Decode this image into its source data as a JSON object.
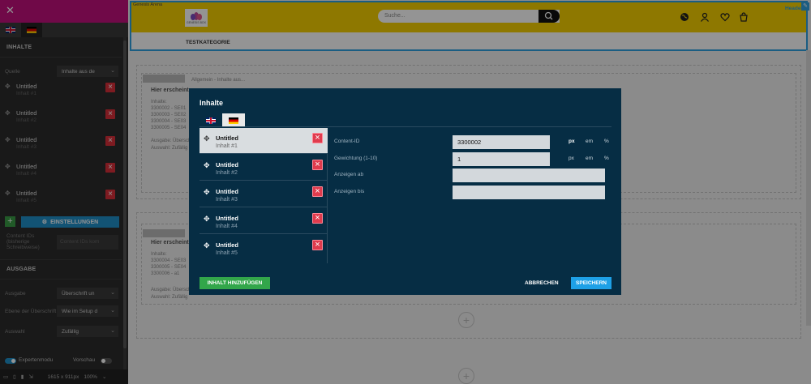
{
  "sidebar": {
    "flags": [
      "flag-uk-icon",
      "flag-de-icon"
    ],
    "section_contents": "INHALTE",
    "source_label": "Quelle",
    "source_value": "Inhalte aus de",
    "items": [
      {
        "title": "Untitled",
        "sub": "Inhalt #1"
      },
      {
        "title": "Untitled",
        "sub": "Inhalt #2"
      },
      {
        "title": "Untitled",
        "sub": "Inhalt #3"
      },
      {
        "title": "Untitled",
        "sub": "Inhalt #4"
      },
      {
        "title": "Untitled",
        "sub": "Inhalt #5"
      }
    ],
    "settings_label": "EINSTELLUNGEN",
    "content_ids_label": "Content IDs (bisherige Schreibweise)",
    "content_ids_placeholder": "Content IDs kom",
    "section_output": "AUSGABE",
    "output_label": "Ausgabe",
    "output_value": "Überschrift un",
    "level_label": "Ebene der Überschrift",
    "level_value": "Wie im Setup d",
    "selection_label": "Auswahl",
    "selection_value": "Zufällig",
    "expert_mode": "Expertenmodu",
    "preview": "Vorschau",
    "resolution": "1615 x 911px",
    "zoom": "100%"
  },
  "page": {
    "header_tag": "Genesis Arena",
    "header_name": "Header",
    "logo_text": "GENESIS BOX",
    "search_placeholder": "Suche...",
    "nav_item": "TESTKATEGORIE",
    "block1_placeholder": "Hier erscheint",
    "block1_info": "Inhalte:\n3300002 - SE01\n3300003 - SE02\n3300004 - SE03\n3300005 - SE04",
    "block1_output": "Ausgabe: Überschri",
    "block1_selection": "Auswahl: Zufällig",
    "block1_note": "Allgemein - Inhalte aus...",
    "block2_placeholder": "Hier erscheint",
    "block2_info": "Inhalte:\n3300004 - SE03\n3300005 - SE04\n3300006 - a1",
    "block2_output": "Ausgabe: Überschri",
    "block2_selection": "Auswahl: Zufällig"
  },
  "modal": {
    "title": "Inhalte",
    "flags": [
      "flag-uk-icon",
      "flag-de-icon"
    ],
    "items": [
      {
        "title": "Untitled",
        "sub": "Inhalt #1"
      },
      {
        "title": "Untitled",
        "sub": "Inhalt #2"
      },
      {
        "title": "Untitled",
        "sub": "Inhalt #3"
      },
      {
        "title": "Untitled",
        "sub": "Inhalt #4"
      },
      {
        "title": "Untitled",
        "sub": "Inhalt #5"
      }
    ],
    "content_id_label": "Content-ID",
    "content_id_value": "3300002",
    "weight_label": "Gewichtung (1-10)",
    "weight_value": "1",
    "show_from_label": "Anzeigen ab",
    "show_from_value": "",
    "show_until_label": "Anzeigen bis",
    "show_until_value": "",
    "unit_px": "px",
    "unit_em": "em",
    "unit_pct": "%",
    "add_button": "INHALT HINZUFÜGEN",
    "cancel_button": "ABBRECHEN",
    "save_button": "SPEICHERN"
  },
  "colors": {
    "sidebar_top": "#c1107d",
    "header_yellow": "#f4cf00",
    "modal_bg": "#062d44",
    "accent_blue": "#1ea0e6",
    "add_green": "#32a64a",
    "delete_red": "#e03b4d"
  }
}
